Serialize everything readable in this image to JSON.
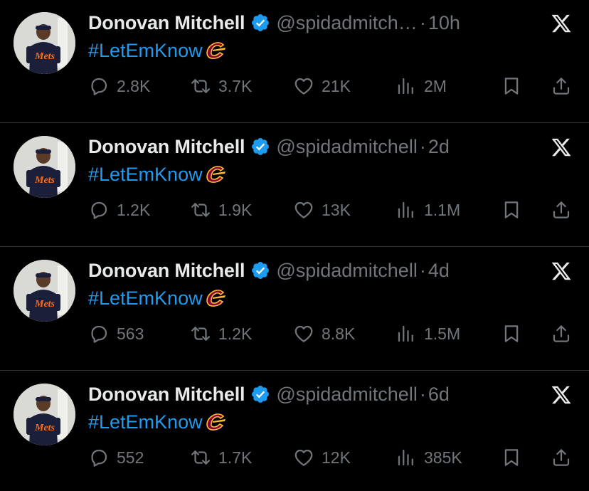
{
  "colors": {
    "background": "#000000",
    "name": "#e7e9ea",
    "secondary": "#71767b",
    "link": "#1d9bf0",
    "verified": "#1d9bf0",
    "divider": "#2f3336"
  },
  "icons": {
    "reply": "speech-bubble",
    "retweet": "retweet-arrows",
    "like": "heart-outline",
    "views": "bar-chart",
    "bookmark": "bookmark",
    "share": "upload-arrow",
    "platform": "x-logo",
    "verified": "blue-checkmark-badge",
    "emoji": "cavaliers-c-logo"
  },
  "tweets": [
    {
      "name": "Donovan Mitchell",
      "handle": "@spidadmitch…",
      "separator": "·",
      "time": "10h",
      "hashtag": "#LetEmKnow",
      "replies": "2.8K",
      "retweets": "3.7K",
      "likes": "21K",
      "views": "2M"
    },
    {
      "name": "Donovan Mitchell",
      "handle": "@spidadmitchell",
      "separator": "·",
      "time": "2d",
      "hashtag": "#LetEmKnow",
      "replies": "1.2K",
      "retweets": "1.9K",
      "likes": "13K",
      "views": "1.1M"
    },
    {
      "name": "Donovan Mitchell",
      "handle": "@spidadmitchell",
      "separator": "·",
      "time": "4d",
      "hashtag": "#LetEmKnow",
      "replies": "563",
      "retweets": "1.2K",
      "likes": "8.8K",
      "views": "1.5M"
    },
    {
      "name": "Donovan Mitchell",
      "handle": "@spidadmitchell",
      "separator": "·",
      "time": "6d",
      "hashtag": "#LetEmKnow",
      "replies": "552",
      "retweets": "1.7K",
      "likes": "12K",
      "views": "385K"
    }
  ]
}
